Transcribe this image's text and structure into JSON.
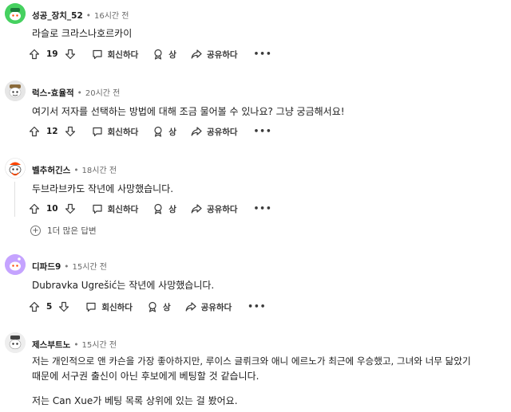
{
  "comments": [
    {
      "user": "성공_장치_52",
      "dot": "•",
      "time": "16시간 전",
      "body": [
        "라슬로 크라스나호르카이"
      ],
      "votes": "19",
      "reply": "회신하다",
      "award": "상",
      "share": "공유하다",
      "more": "•••",
      "avatar_color": "#46d160"
    },
    {
      "user": "럭스-효율적",
      "dot": "•",
      "time": "20시간 전",
      "body": [
        "여기서 저자를 선택하는 방법에 대해 조금 물어볼 수 있나요? 그냥 궁금해서요!"
      ],
      "votes": "12",
      "reply": "회신하다",
      "award": "상",
      "share": "공유하다",
      "more": "•••",
      "avatar_color": "#dcdcdc"
    },
    {
      "user": "벨추허긴스",
      "dot": "•",
      "time": "18시간 전",
      "body": [
        "두브라브카도 작년에 사망했습니다."
      ],
      "votes": "10",
      "reply": "회신하다",
      "award": "상",
      "share": "공유하다",
      "more": "•••",
      "avatar_color": "#ff4500",
      "more_replies": "1더 많은 답변"
    },
    {
      "user": "디파드9",
      "dot": "•",
      "time": "15시간 전",
      "body": [
        "Dubravka Ugrešić는 작년에 사망했습니다."
      ],
      "votes": "5",
      "reply": "회신하다",
      "award": "상",
      "share": "공유하다",
      "more": "•••",
      "avatar_color": "#c5a3ff"
    },
    {
      "user": "제스부트노",
      "dot": "•",
      "time": "15시간 전",
      "body": [
        "저는 개인적으로 앤 카슨을 가장 좋아하지만, 루이스 글뤼크와 애니 에르노가 최근에 우승했고, 그녀와 너무 닮았기",
        "때문에 서구권 출신이 아닌 후보에게 베팅할 것 같습니다.",
        "",
        "저는 Can Xue가 베팅 목록 상위에 있는 걸 봤어요."
      ],
      "avatar_color": "#e8e8e8"
    }
  ]
}
